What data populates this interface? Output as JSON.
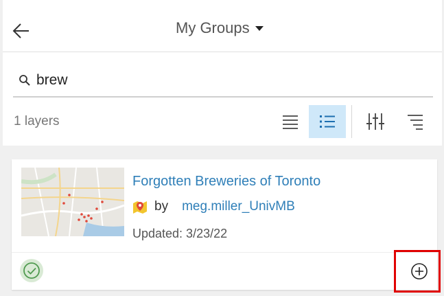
{
  "header": {
    "title": "My Groups"
  },
  "search": {
    "value": "brew",
    "placeholder": ""
  },
  "toolbar": {
    "count_label": "1 layers"
  },
  "results": [
    {
      "title": "Forgotten Breweries of Toronto",
      "by_label": "by",
      "owner": "meg.miller_UnivMB",
      "updated": "Updated: 3/23/22",
      "type_icon": "map-marker-icon",
      "status_icon": "check-circle-icon",
      "add_icon": "add-circle-icon"
    }
  ],
  "colors": {
    "accent": "#2f7fb8",
    "active_view_bg": "#cfe8f9",
    "highlight": "#e00000",
    "check": "#4f9a4f"
  }
}
